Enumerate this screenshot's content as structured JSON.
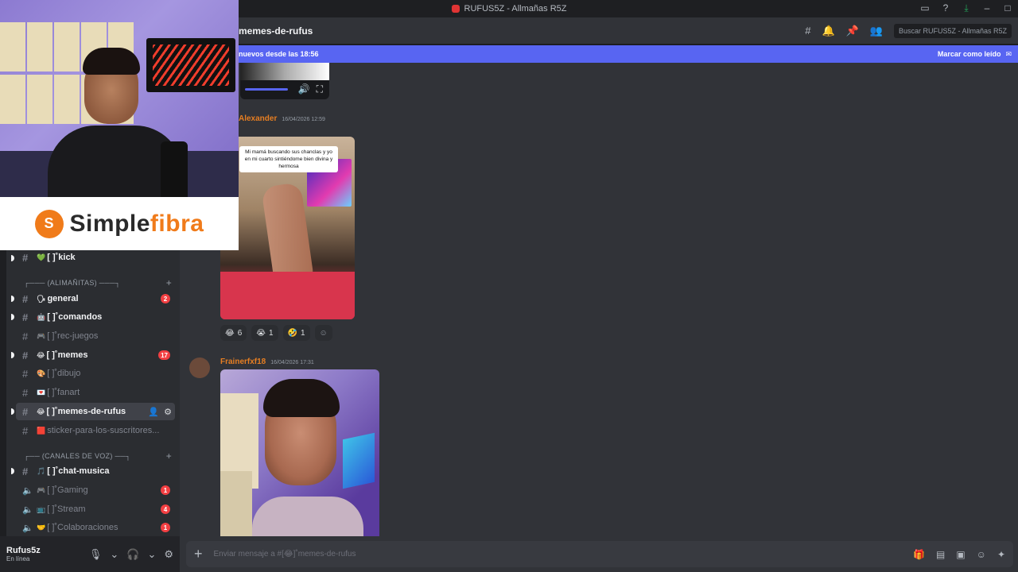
{
  "window": {
    "title": "RUFUS5Z - Allmañas R5Z"
  },
  "header": {
    "channel_name": "memes-de-rufus",
    "search_placeholder": "Buscar RUFUS5Z - Allmañas R5Z"
  },
  "new_messages_bar": {
    "text": "nuevos desde las 18:56",
    "mark_read": "Marcar como leído"
  },
  "sidebar": {
    "categories": [
      {
        "label": "┌─── (ALIMAÑITAS) ───┐"
      },
      {
        "label": "┌── (CANALES DE VOZ) ──┐"
      }
    ],
    "channels": [
      {
        "emoji": "💚",
        "label": "[   ]˚kick",
        "state": "unread"
      },
      {
        "emoji": "🗣",
        "label": "general",
        "state": "unread",
        "badge": "2"
      },
      {
        "emoji": "🤖",
        "label": "[   ]˚comandos",
        "state": "unread"
      },
      {
        "emoji": "🎮",
        "label": "[   ]˚rec-juegos",
        "state": "muted"
      },
      {
        "emoji": "😂",
        "label": "[   ]˚memes",
        "state": "unread",
        "badge": "17"
      },
      {
        "emoji": "🎨",
        "label": "[   ]˚dibujo",
        "state": "muted"
      },
      {
        "emoji": "💌",
        "label": "[   ]˚fanart",
        "state": "muted"
      },
      {
        "emoji": "😂",
        "label": "[   ]˚memes-de-rufus",
        "state": "active"
      },
      {
        "emoji": "🟥",
        "label": "sticker-para-los-suscritores...",
        "state": "muted"
      },
      {
        "emoji": "🎵",
        "label": "[   ]˚chat-musica",
        "state": "unread"
      },
      {
        "emoji": "🎮",
        "label": "[   ]˚Gaming",
        "state": "voice",
        "badge": "1"
      },
      {
        "emoji": "📺",
        "label": "[   ]˚Stream",
        "state": "voice",
        "badge": "4"
      },
      {
        "emoji": "🤝",
        "label": "[   ]˚Colaboraciones",
        "state": "voice",
        "badge": "1"
      }
    ]
  },
  "user": {
    "name": "Rufus5z",
    "status": "En línea"
  },
  "messages": [
    {
      "author": "Alexander",
      "author_color": "#e67e22",
      "timestamp": "16/04/2026 12:59",
      "image_caption": "Mi mamá buscando sus chanclas y yo en mi cuarto sintiéndome bien divina y hermosa",
      "reactions": [
        {
          "emoji": "😂",
          "count": "6"
        },
        {
          "emoji": "😭",
          "count": "1"
        },
        {
          "emoji": "🤣",
          "count": "1"
        }
      ]
    },
    {
      "author": "Frainerfxf18",
      "author_color": "#e67e22",
      "timestamp": "16/04/2026 17:31"
    }
  ],
  "composer": {
    "placeholder": "Enviar mensaje a #[😂]˚memes-de-rufus"
  },
  "overlay": {
    "brand_a": "Simple",
    "brand_b": "fibra"
  },
  "colors": {
    "accent": "#5865f2",
    "danger": "#f23f42",
    "brand_orange": "#f07b1a"
  }
}
